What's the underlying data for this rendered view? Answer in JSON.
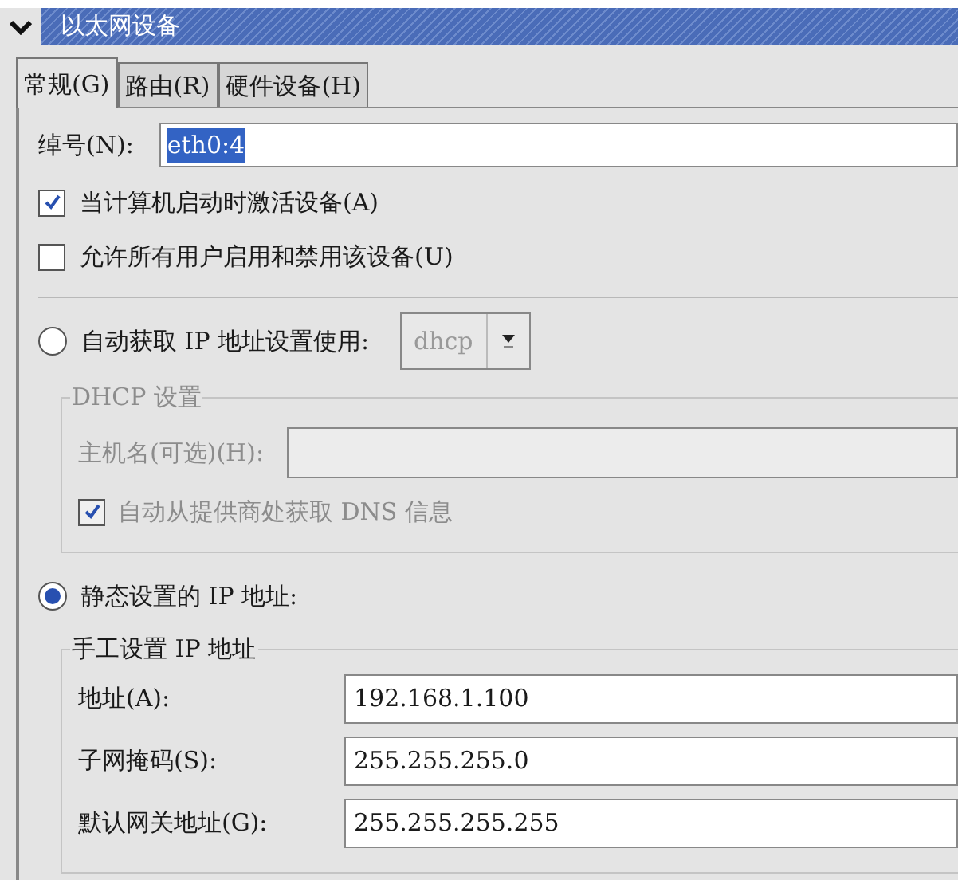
{
  "window": {
    "title": "以太网设备"
  },
  "tabs": [
    {
      "label": "常规(G)",
      "selected": true
    },
    {
      "label": "路由(R)",
      "selected": false
    },
    {
      "label": "硬件设备(H)",
      "selected": false
    }
  ],
  "nickname": {
    "label": "绰号(N):",
    "value": "eth0:4",
    "text_selected": true
  },
  "options": [
    {
      "label": "当计算机启动时激活设备(A)",
      "checked": true
    },
    {
      "label": "允许所有用户启用和禁用该设备(U)",
      "checked": false
    }
  ],
  "auto_ip": {
    "label": "自动获取 IP 地址设置使用:",
    "selected": false,
    "method": "dhcp",
    "disabled": true
  },
  "dhcp_group": {
    "title": "DHCP 设置",
    "disabled": true,
    "hostname_label": "主机名(可选)(H):",
    "dns_label": "自动从提供商处获取 DNS 信息",
    "dns_checked": true
  },
  "static_ip": {
    "label": "静态设置的 IP 地址:",
    "selected": true
  },
  "manual_group": {
    "title": "手工设置 IP 地址",
    "fields": [
      {
        "label": "地址(A):",
        "value": "192.168.1.100"
      },
      {
        "label": "子网掩码(S):",
        "value": "255.255.255.0"
      },
      {
        "label": "默认网关地址(G):",
        "value": "255.255.255.255"
      }
    ]
  }
}
